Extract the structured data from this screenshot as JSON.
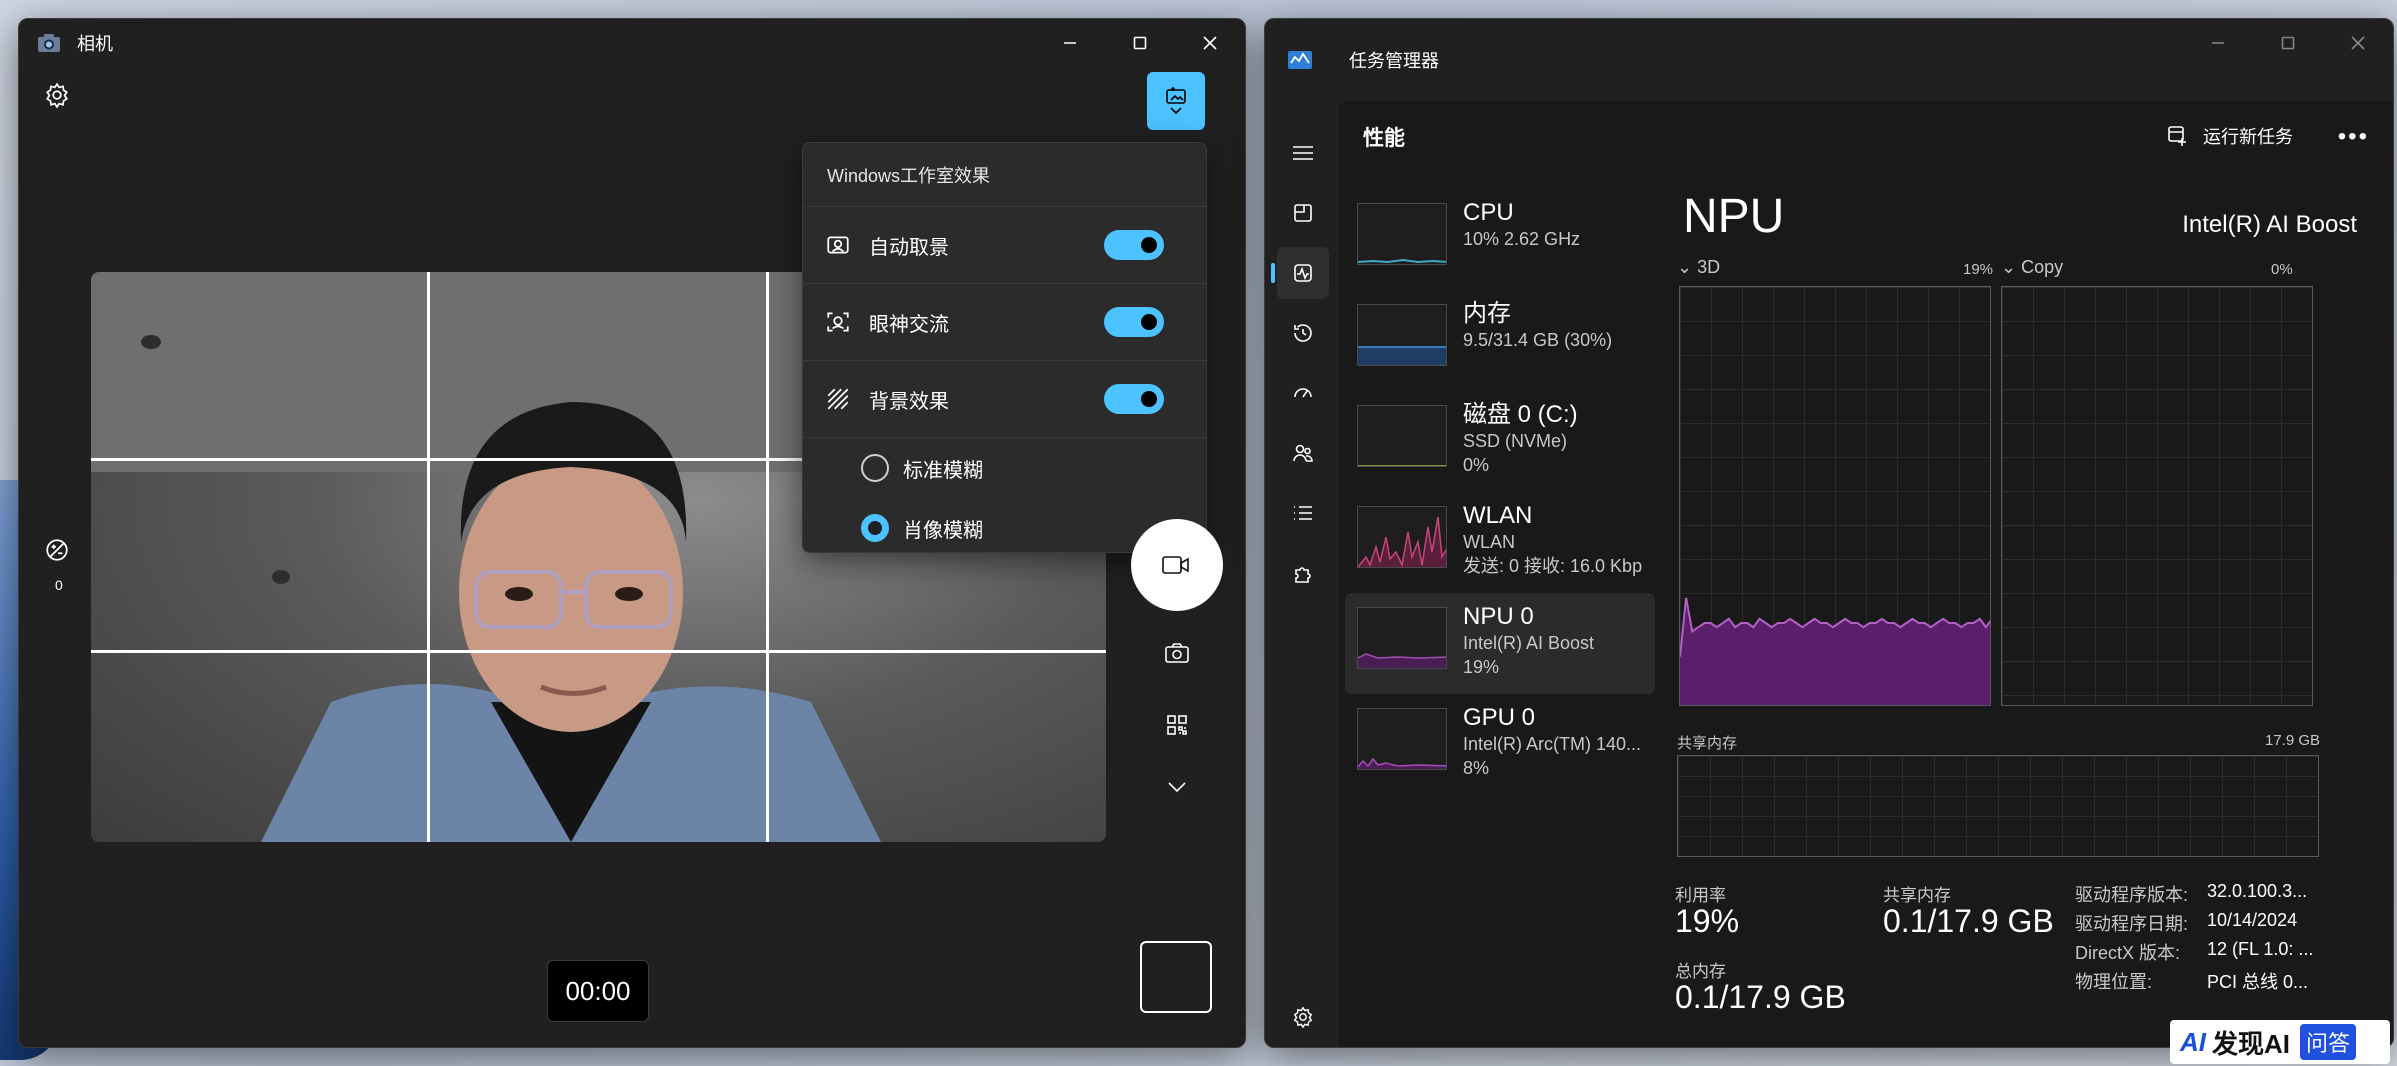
{
  "camera": {
    "title": "相机",
    "counter": "0",
    "timer": "00:00",
    "grid_enabled": true,
    "flyout": {
      "heading": "Windows工作室效果",
      "items": [
        {
          "label": "自动取景",
          "on": true
        },
        {
          "label": "眼神交流",
          "on": true
        },
        {
          "label": "背景效果",
          "on": true
        }
      ],
      "radios": [
        {
          "label": "标准模糊",
          "selected": false
        },
        {
          "label": "肖像模糊",
          "selected": true
        }
      ]
    }
  },
  "taskmgr": {
    "title": "任务管理器",
    "page": "性能",
    "run_task": "运行新任务",
    "devices": [
      {
        "name": "CPU",
        "sub1": "10%  2.62 GHz",
        "sub2": "",
        "color": "#3fa9c9"
      },
      {
        "name": "内存",
        "sub1": "9.5/31.4 GB (30%)",
        "sub2": "",
        "color": "#3a78c2"
      },
      {
        "name": "磁盘 0 (C:)",
        "sub1": "SSD (NVMe)",
        "sub2": "0%",
        "color": "#7fa33a"
      },
      {
        "name": "WLAN",
        "sub1": "WLAN",
        "sub2": "发送: 0  接收: 16.0 Kbp",
        "color": "#c8457a"
      },
      {
        "name": "NPU 0",
        "sub1": "Intel(R) AI Boost",
        "sub2": "19%",
        "color": "#a34fb5"
      },
      {
        "name": "GPU 0",
        "sub1": "Intel(R) Arc(TM) 140...",
        "sub2": "8%",
        "color": "#a34fb5"
      }
    ],
    "detail": {
      "title": "NPU",
      "model": "Intel(R) AI Boost",
      "graph1_label": "3D",
      "graph1_pct": "19%",
      "graph2_label": "Copy",
      "graph2_pct": "0%",
      "shared_label": "共享内存",
      "shared_max": "17.9 GB",
      "util_label": "利用率",
      "util_value": "19%",
      "shared_mem_label": "共享内存",
      "shared_mem_value": "0.1/17.9 GB",
      "total_label": "总内存",
      "total_value": "0.1/17.9 GB",
      "props": [
        {
          "k": "驱动程序版本:",
          "v": "32.0.100.3..."
        },
        {
          "k": "驱动程序日期:",
          "v": "10/14/2024"
        },
        {
          "k": "DirectX 版本:",
          "v": "12 (FL 1.0: ..."
        },
        {
          "k": "物理位置:",
          "v": "PCI 总线 0..."
        }
      ],
      "npu_series": [
        12,
        26,
        18,
        19,
        20,
        20,
        19,
        20,
        21,
        19,
        20,
        20,
        19,
        21,
        20,
        19,
        20,
        20,
        21,
        20,
        19,
        20,
        21,
        20,
        20,
        19,
        20,
        21,
        20,
        20,
        19,
        20,
        20,
        21,
        20,
        20,
        19,
        20,
        21,
        20,
        20,
        19,
        20,
        21,
        20,
        20,
        19,
        20,
        20,
        21,
        19,
        21
      ]
    }
  },
  "watermark": {
    "logo": "AI",
    "text": "发现AI",
    "tag": "问答"
  }
}
